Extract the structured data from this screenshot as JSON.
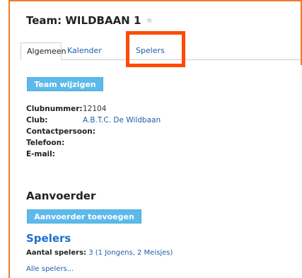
{
  "header": {
    "title": "Team: WILDBAAN 1",
    "star": "★"
  },
  "tabs": [
    {
      "label": "Algemeen"
    },
    {
      "label": "Kalender"
    },
    {
      "label": "Spelers"
    }
  ],
  "buttons": {
    "team_edit": "Team wijzigen",
    "add_captain": "Aanvoerder toevoegen"
  },
  "info": {
    "clubnummer_label": "Clubnummer:",
    "clubnummer_value": "12104",
    "club_label": "Club:",
    "club_value": "A.B.T.C. De Wildbaan",
    "contact_label": "Contactpersoon:",
    "telefoon_label": "Telefoon:",
    "email_label": "E-mail:"
  },
  "sections": {
    "aanvoerder": "Aanvoerder",
    "spelers": "Spelers"
  },
  "players": {
    "count_label": "Aantal spelers:",
    "count_value": "3 (1 Jongens, 2 Meisjes)",
    "all_link": "Alle spelers..."
  },
  "colors": {
    "accent": "#5db9ea",
    "highlight": "#ff4b00",
    "frame": "#f07a2c",
    "link": "#1e5fa8"
  }
}
